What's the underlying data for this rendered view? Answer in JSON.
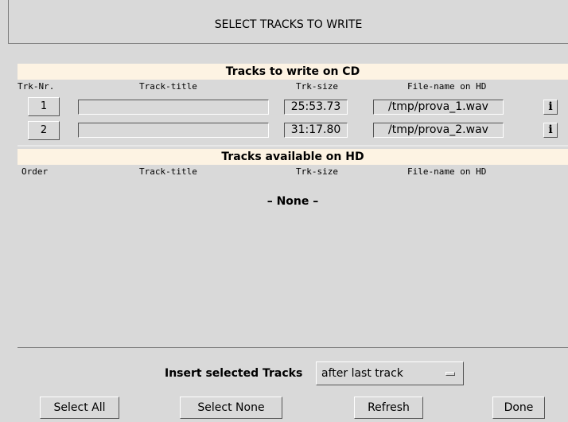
{
  "header": {
    "title": "SELECT TRACKS TO WRITE"
  },
  "cd_section": {
    "title": "Tracks to write on CD",
    "columns": {
      "nr": "Trk-Nr.",
      "title": "Track-title",
      "size": "Trk-size",
      "file": "File-name on HD"
    },
    "rows": [
      {
        "nr": "1",
        "title": "",
        "size": "25:53.73",
        "file": "/tmp/prova_1.wav"
      },
      {
        "nr": "2",
        "title": "",
        "size": "31:17.80",
        "file": "/tmp/prova_2.wav"
      }
    ],
    "info_glyph": "i"
  },
  "hd_section": {
    "title": "Tracks available on HD",
    "columns": {
      "order": "Order",
      "title": "Track-title",
      "size": "Trk-size",
      "file": "File-name on HD"
    },
    "empty_text": "– None –"
  },
  "insert": {
    "label": "Insert selected Tracks",
    "selected_option": "after last track"
  },
  "buttons": {
    "select_all": "Select All",
    "select_none": "Select None",
    "refresh": "Refresh",
    "done": "Done"
  },
  "icons": {
    "info": "info-icon",
    "dropdown": "option-menu-indicator-icon"
  }
}
